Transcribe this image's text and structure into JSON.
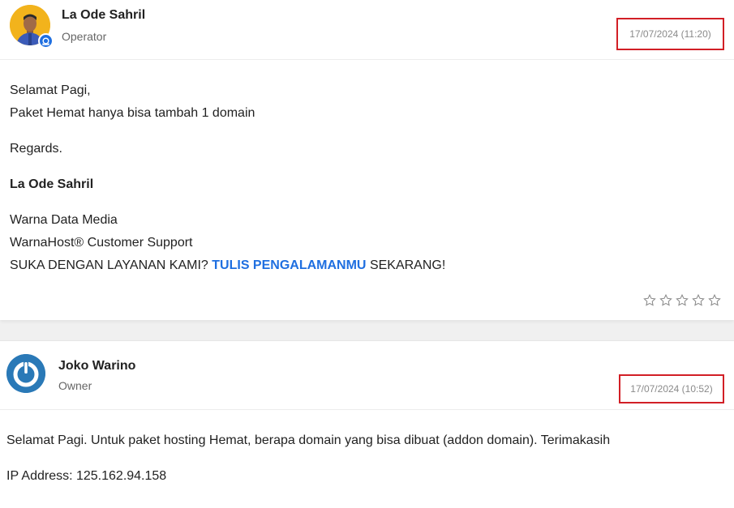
{
  "messages": [
    {
      "name": "La Ode Sahril",
      "role": "Operator",
      "timestamp": "17/07/2024 (11:20)",
      "lines": [
        "Selamat Pagi,",
        "Paket Hemat hanya bisa tambah 1 domain"
      ],
      "regards": "Regards.",
      "signature_name": "La Ode Sahril",
      "sig_lines": [
        "Warna Data Media",
        "WarnaHost® Customer Support"
      ],
      "cta_prefix": "SUKA DENGAN LAYANAN KAMI?",
      "cta_link": "TULIS PENGALAMANMU",
      "cta_suffix": "SEKARANG!",
      "rating_icons": [
        "star-outline",
        "star-outline",
        "star-outline",
        "star-outline",
        "star-outline"
      ]
    },
    {
      "name": "Joko Warino",
      "role": "Owner",
      "timestamp": "17/07/2024 (10:52)",
      "text": "Selamat Pagi. Untuk paket hosting Hemat, berapa domain yang bisa dibuat (addon domain). Terimakasih",
      "ip": "IP Address: 125.162.94.158"
    }
  ]
}
